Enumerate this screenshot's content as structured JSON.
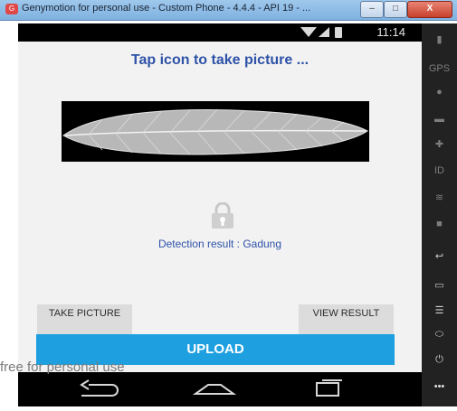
{
  "window": {
    "title": "Genymotion for personal use - Custom Phone - 4.4.4 - API 19 - ...",
    "minimize": "–",
    "maximize": "□",
    "close": "X"
  },
  "status_bar": {
    "time": "11:14"
  },
  "app": {
    "heading": "Tap icon to take picture ...",
    "result_text": "Detection result : Gadung",
    "take_picture_label": "TAKE PICTURE",
    "view_result_label": "VIEW RESULT",
    "upload_label": "UPLOAD"
  },
  "watermark": "free for personal use",
  "side_panel": {
    "gps": "GPS",
    "id": "ID"
  }
}
